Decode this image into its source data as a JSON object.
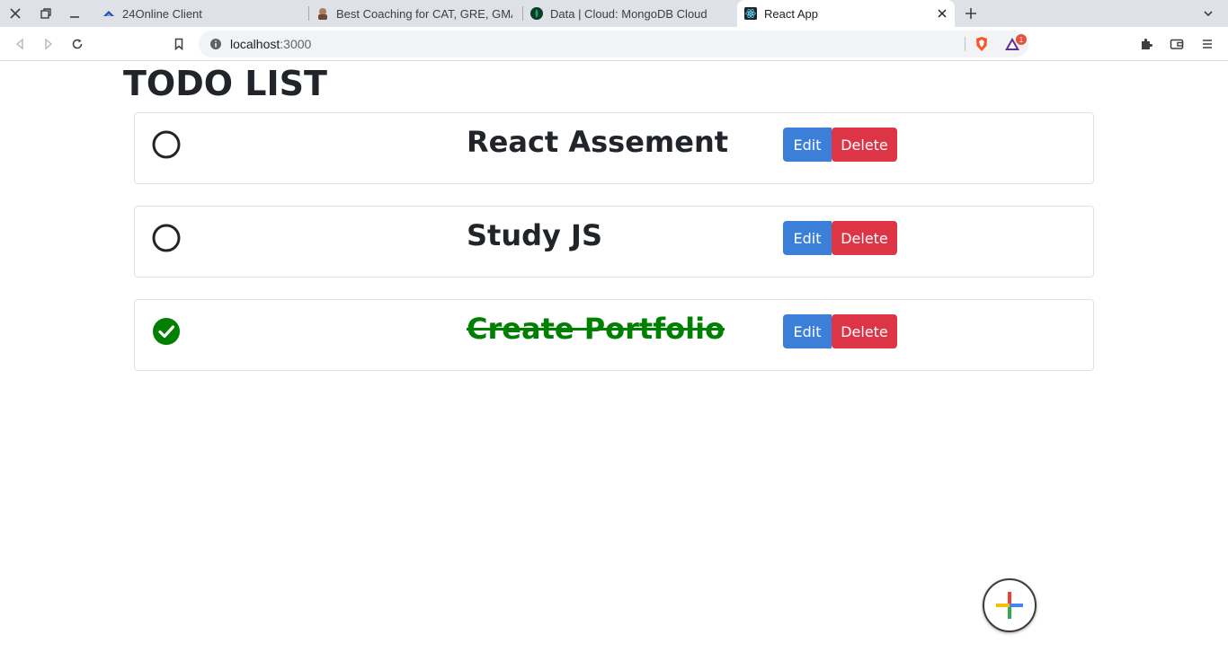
{
  "browser": {
    "tabs": [
      {
        "title": "24Online Client",
        "favicon": "24online-icon"
      },
      {
        "title": "Best Coaching for CAT, GRE, GMAT, ...",
        "favicon": "avatar-icon"
      },
      {
        "title": "Data | Cloud: MongoDB Cloud",
        "favicon": "mongodb-leaf-icon"
      },
      {
        "title": "React App",
        "favicon": "react-icon",
        "active": true
      }
    ],
    "address": {
      "host": "localhost",
      "port": ":3000"
    },
    "rewards_badge": "1"
  },
  "page": {
    "title": "TODO LIST",
    "todos": [
      {
        "text": "React Assement",
        "completed": false,
        "edit_label": "Edit",
        "delete_label": "Delete"
      },
      {
        "text": "Study JS",
        "completed": false,
        "edit_label": "Edit",
        "delete_label": "Delete"
      },
      {
        "text": "Create Portfolio",
        "completed": true,
        "edit_label": "Edit",
        "delete_label": "Delete"
      }
    ]
  },
  "colors": {
    "completed_text": "#008000",
    "edit_button": "#3c7fd9",
    "delete_button": "#dc3545",
    "fab_plus": [
      "#4285f4",
      "#ea4335",
      "#fbbc05",
      "#34a853"
    ]
  }
}
